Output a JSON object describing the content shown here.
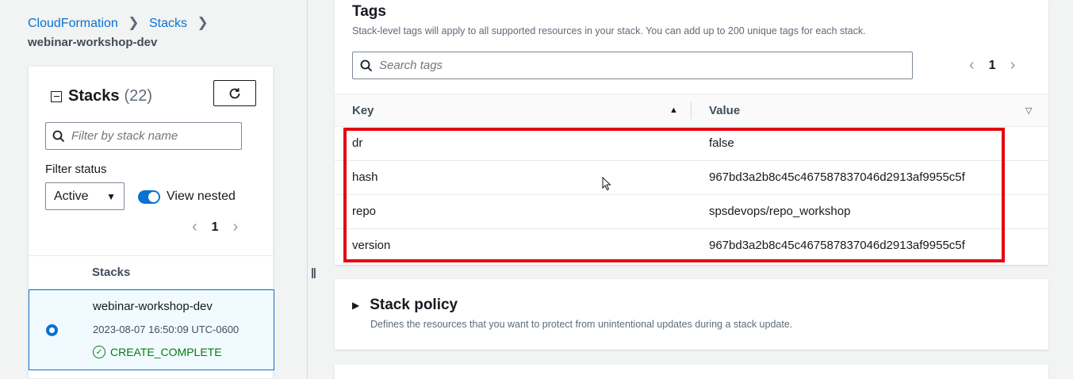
{
  "breadcrumb": {
    "root": "CloudFormation",
    "section": "Stacks",
    "current": "webinar-workshop-dev"
  },
  "stacks_panel": {
    "title": "Stacks",
    "count": "(22)",
    "filter_placeholder": "Filter by stack name",
    "filter_status_label": "Filter status",
    "status_value": "Active",
    "view_nested_label": "View nested",
    "page": "1",
    "column_header": "Stacks",
    "rows": [
      {
        "name": "webinar-workshop-dev",
        "timestamp": "2023-08-07 16:50:09 UTC-0600",
        "status": "CREATE_COMPLETE"
      }
    ]
  },
  "tags_panel": {
    "title": "Tags",
    "description": "Stack-level tags will apply to all supported resources in your stack. You can add up to 200 unique tags for each stack.",
    "search_placeholder": "Search tags",
    "page": "1",
    "columns": {
      "key": "Key",
      "value": "Value"
    },
    "rows": [
      {
        "key": "dr",
        "value": "false"
      },
      {
        "key": "hash",
        "value": "967bd3a2b8c45c467587837046d2913af9955c5f"
      },
      {
        "key": "repo",
        "value": "spsdevops/repo_workshop"
      },
      {
        "key": "version",
        "value": "967bd3a2b8c45c467587837046d2913af9955c5f"
      }
    ]
  },
  "policy_panel": {
    "title": "Stack policy",
    "description": "Defines the resources that you want to protect from unintentional updates during a stack update."
  },
  "colors": {
    "accent": "#0972d3",
    "success": "#037f0c",
    "highlight": "#e30613"
  }
}
